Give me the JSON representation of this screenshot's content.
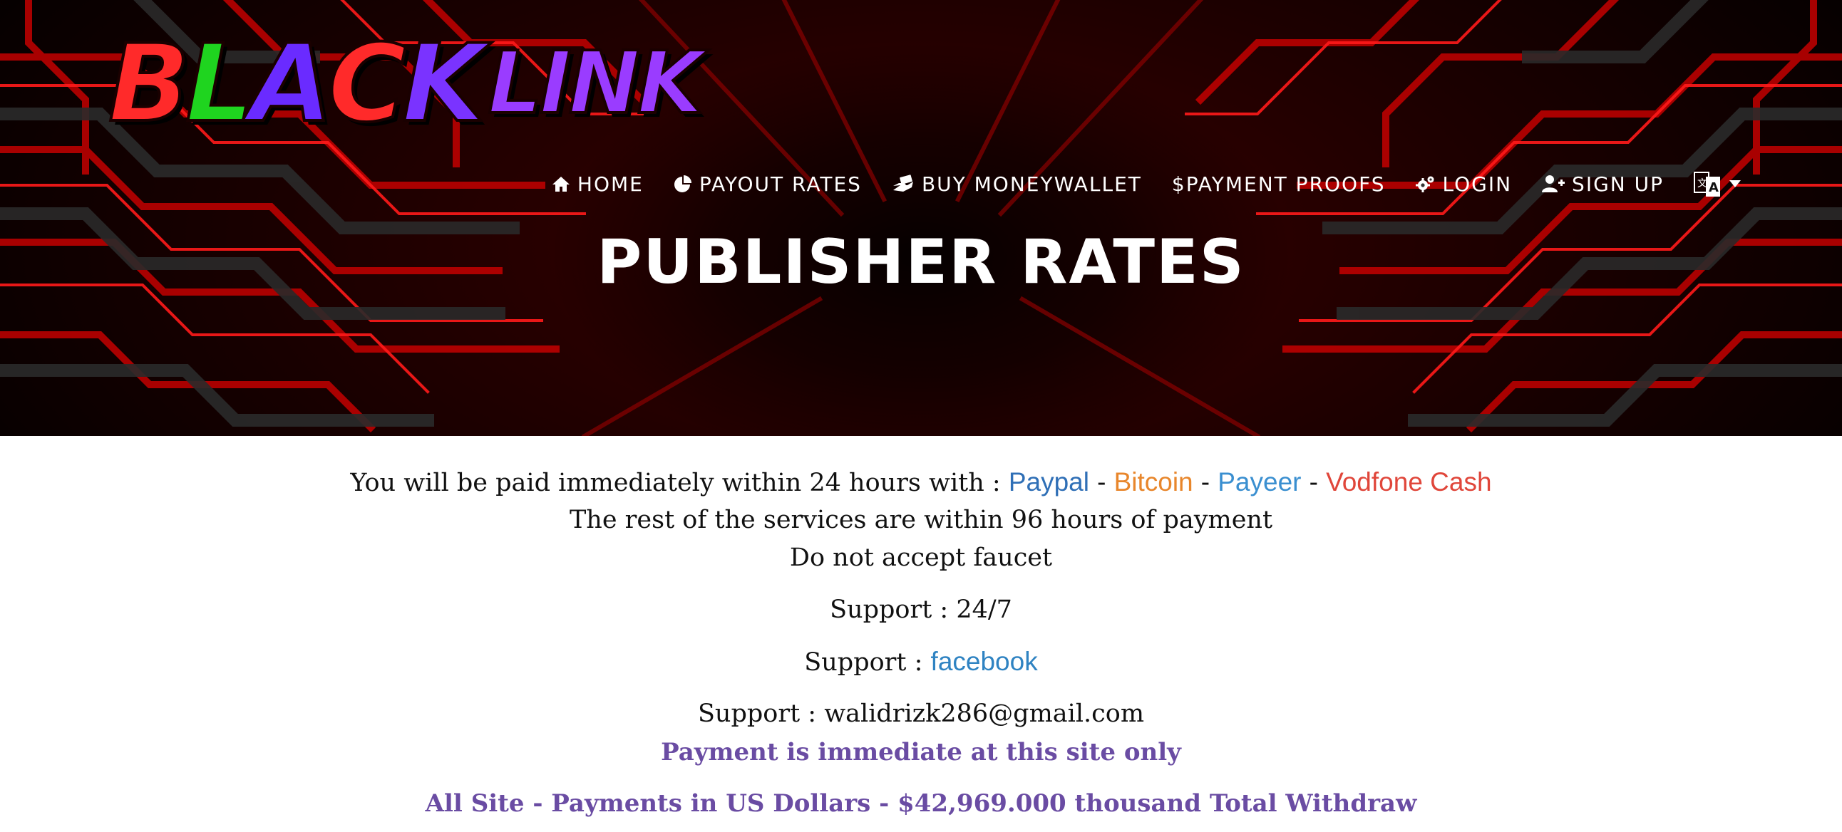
{
  "logo": {
    "black": "BLACK",
    "link": "LINK",
    "letter_colors": [
      "#ff2a2a",
      "#1fd41f",
      "#6a2bff",
      "#ff2a2a",
      "#7a33ff",
      "#ff2a2a",
      "#8a2be2"
    ]
  },
  "nav": {
    "items": [
      {
        "label": "HOME",
        "icon": "home-icon"
      },
      {
        "label": "PAYOUT RATES",
        "icon": "pie-chart-icon"
      },
      {
        "label": "BUY MONEYWALLET",
        "icon": "money-hand-icon"
      },
      {
        "label": "$PAYMENT PROOFS",
        "icon": ""
      },
      {
        "label": "LOGIN",
        "icon": "gears-icon"
      },
      {
        "label": "SIGN UP",
        "icon": "user-plus-icon"
      }
    ],
    "language_icon": "language-icon",
    "dropdown_icon": "caret-down-icon"
  },
  "hero": {
    "title": "PUBLISHER RATES"
  },
  "content": {
    "paid_prefix": "You will be paid immediately within 24 hours with :",
    "paypal": "Paypal",
    "bitcoin": "Bitcoin",
    "payeer": "Payeer",
    "vodafone": "Vodfone Cash",
    "separator": "-",
    "rest_services": "The rest of the services are within 96 hours of payment",
    "no_faucet": "Do not accept faucet",
    "support_hours": "Support : 24/7",
    "support_label": "Support :",
    "facebook": "facebook",
    "support_email": "Support : walidrizk286@gmail.com",
    "payment_immediate": "Payment is immediate at this site only",
    "all_site": "All Site - Payments in US Dollars - $42,969.000 thousand Total Withdraw"
  },
  "colors": {
    "paypal": "#2f6fb6",
    "bitcoin": "#e8862b",
    "payeer": "#3a8fd0",
    "vodafone": "#e0463a",
    "facebook": "#2f83c2",
    "purple": "#6a4ca3"
  }
}
